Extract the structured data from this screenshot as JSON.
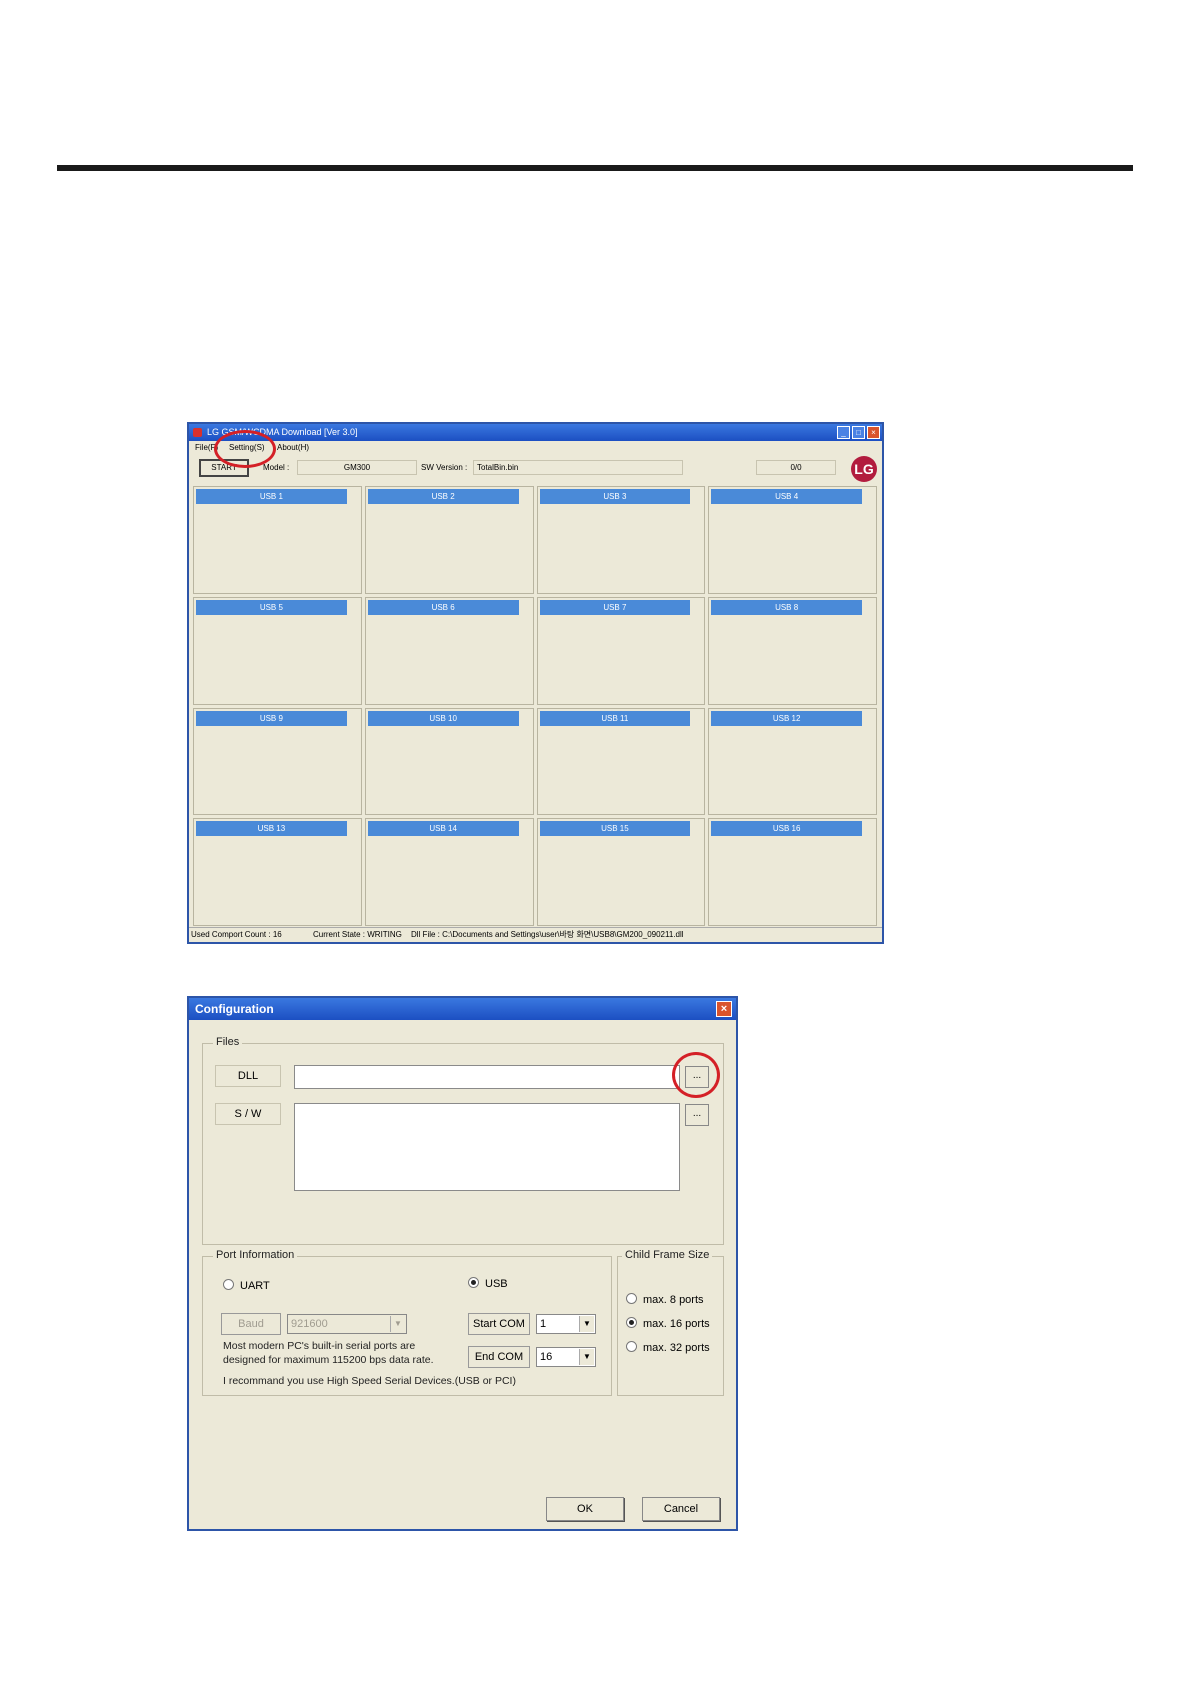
{
  "main_window": {
    "title": "LG GSM/WCDMA Download [Ver 3.0]",
    "menu": [
      "File(F)",
      "Setting(S)",
      "About(H)"
    ],
    "start_label": "START",
    "model_label": "Model :",
    "model_value": "GM300",
    "sw_version_label": "SW Version :",
    "sw_version_value": "TotalBin.bin",
    "counter": "0/0",
    "logo_text": "LG",
    "usb_slots": [
      "USB 1",
      "USB 2",
      "USB 3",
      "USB 4",
      "USB 5",
      "USB 6",
      "USB 7",
      "USB 8",
      "USB 9",
      "USB 10",
      "USB 11",
      "USB 12",
      "USB 13",
      "USB 14",
      "USB 15",
      "USB 16"
    ],
    "status": {
      "comport": "Used Comport Count : 16",
      "state": "Current State : WRITING",
      "dll_file": "Dll File : C:\\Documents and Settings\\user\\바탕 화면\\USB8\\GM200_090211.dll"
    }
  },
  "config_dialog": {
    "title": "Configuration",
    "files_group": "Files",
    "dll_label": "DLL",
    "sw_label": "S / W",
    "dll_value": "",
    "sw_value": "",
    "browse_label": "...",
    "port_group": "Port Information",
    "uart_label": "UART",
    "usb_label": "USB",
    "baud_label": "Baud",
    "baud_value": "921600",
    "start_com_label": "Start COM",
    "start_com_value": "1",
    "end_com_label": "End COM",
    "end_com_value": "16",
    "note_line1": "Most modern PC's built-in serial ports are",
    "note_line2": "designed for maximum 115200 bps data rate.",
    "note_line3": "I recommand you use High Speed Serial Devices.(USB or PCI)",
    "frame_group": "Child Frame Size",
    "frame_options": [
      "max. 8 ports",
      "max. 16 ports",
      "max. 32 ports"
    ],
    "frame_selected": 1,
    "ok_label": "OK",
    "cancel_label": "Cancel"
  },
  "colors": {
    "annotation": "#d42027",
    "titlebar": "#2d5fcf",
    "slot_header": "#4a8ad8",
    "window_bg": "#ece9d8"
  }
}
